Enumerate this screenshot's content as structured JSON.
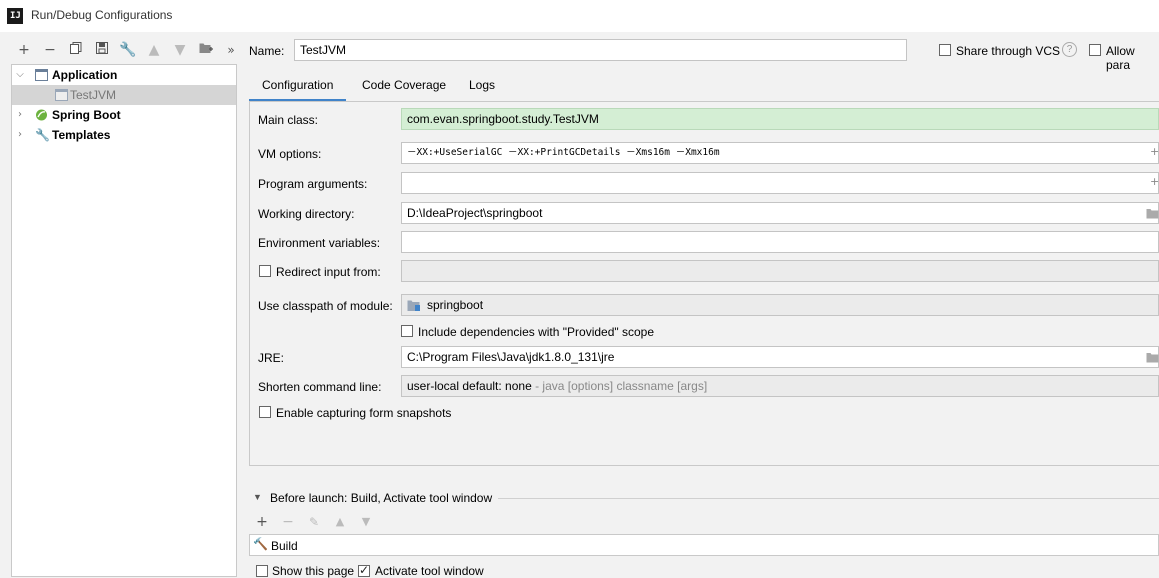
{
  "window": {
    "title": "Run/Debug Configurations",
    "app_icon": "IJ"
  },
  "toolbar": {
    "icons": [
      "add-icon",
      "remove-icon",
      "copy-icon",
      "save-icon",
      "wrench-icon",
      "move-up-icon",
      "move-down-icon",
      "folder-add-icon",
      "more-icon"
    ]
  },
  "tree": {
    "items": [
      {
        "label": "Application",
        "bold": true,
        "expanded": true
      },
      {
        "label": "TestJVM",
        "selected": true
      },
      {
        "label": "Spring Boot",
        "bold": true,
        "expanded": false
      },
      {
        "label": "Templates",
        "bold": true,
        "expanded": false
      }
    ]
  },
  "header": {
    "name_label": "Name:",
    "name_value": "TestJVM",
    "share_label": "Share through VCS",
    "help_glyph": "?",
    "allow_label": "Allow para"
  },
  "tabs": [
    {
      "label": "Configuration",
      "active": true
    },
    {
      "label": "Code Coverage"
    },
    {
      "label": "Logs"
    }
  ],
  "form": {
    "main_class_label": "Main class:",
    "main_class_value": "com.evan.springboot.study.TestJVM",
    "vm_options_label": "VM options:",
    "vm_options_value": "－XX:+UseSerialGC －XX:+PrintGCDetails －Xms16m －Xmx16m",
    "program_args_label": "Program arguments:",
    "program_args_value": "",
    "working_dir_label": "Working directory:",
    "working_dir_value": "D:\\IdeaProject\\springboot",
    "env_vars_label": "Environment variables:",
    "env_vars_value": "",
    "redirect_label": "Redirect input from:",
    "classpath_label": "Use classpath of module:",
    "classpath_value": "springboot",
    "include_deps_label": "Include dependencies with \"Provided\" scope",
    "jre_label": "JRE:",
    "jre_value": "C:\\Program Files\\Java\\jdk1.8.0_131\\jre",
    "shorten_label": "Shorten command line:",
    "shorten_value": "user-local default: none",
    "shorten_hint": " - java [options] classname [args]",
    "snapshots_label": "Enable capturing form snapshots",
    "expand_glyph": "+"
  },
  "before_launch": {
    "title": "Before launch: Build, Activate tool window",
    "icons": [
      "add-icon",
      "remove-icon",
      "edit-icon",
      "move-up-icon",
      "move-down-icon"
    ],
    "item_label": "Build"
  },
  "footer": {
    "show_page_label": "Show this page",
    "activate_label": "Activate tool window"
  },
  "colors": {
    "accent": "#4083c9",
    "main_class_bg": "#d4eed4",
    "selected_row": "#d5d5d5"
  }
}
